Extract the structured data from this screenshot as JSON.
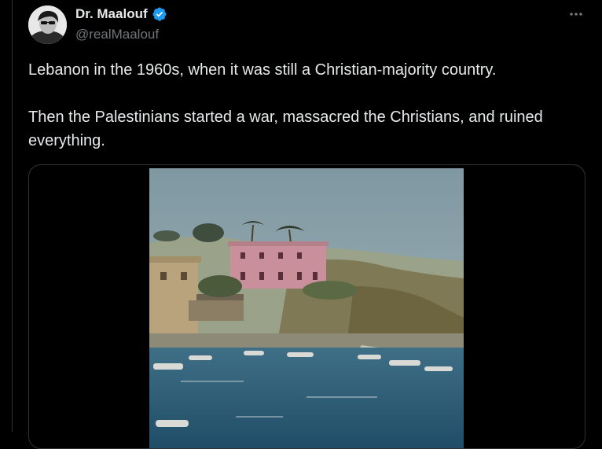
{
  "author": {
    "display_name": "Dr. Maalouf",
    "handle": "@realMaalouf",
    "verified": true
  },
  "icons": {
    "verified": "verified-badge-icon",
    "more": "more-options-icon"
  },
  "tweet": {
    "paragraphs": [
      "Lebanon in the 1960s, when it was still a Christian-majority country.",
      "Then the Palestinians started a war, massacred the Christians, and ruined everything."
    ]
  },
  "colors": {
    "background": "#000000",
    "text_primary": "#e7e9ea",
    "text_secondary": "#71767b",
    "verified_blue": "#1d9bf0",
    "border": "#2f3336"
  }
}
